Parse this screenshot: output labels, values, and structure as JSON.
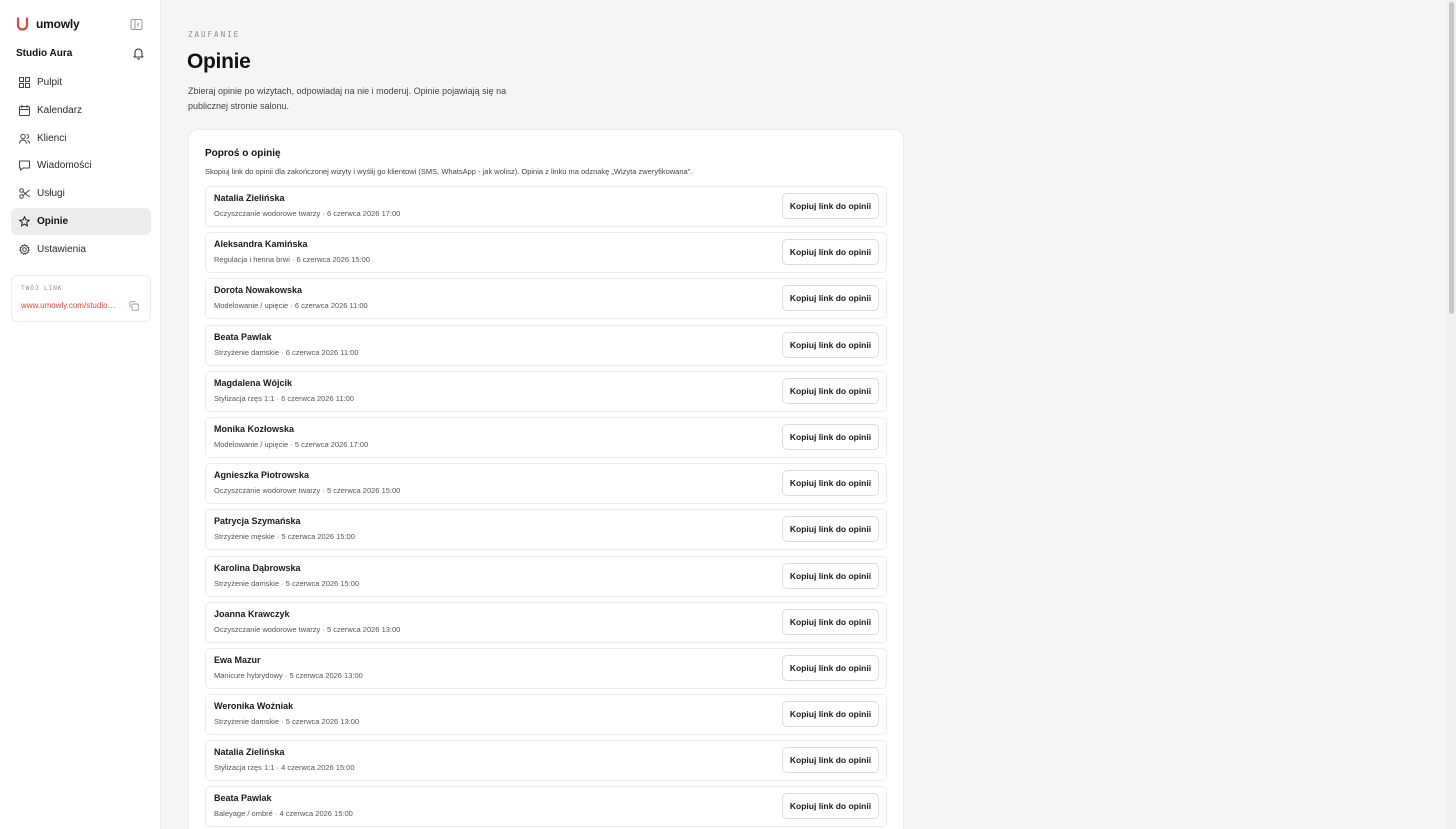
{
  "brand": {
    "name": "umowly",
    "accent": "#e0453a"
  },
  "sidebar": {
    "studio_name": "Studio Aura",
    "items": [
      {
        "label": "Pulpit",
        "icon": "dashboard-icon"
      },
      {
        "label": "Kalendarz",
        "icon": "calendar-icon"
      },
      {
        "label": "Klienci",
        "icon": "users-icon"
      },
      {
        "label": "Wiadomości",
        "icon": "message-icon"
      },
      {
        "label": "Usługi",
        "icon": "scissors-icon"
      },
      {
        "label": "Opinie",
        "icon": "star-icon",
        "active": true
      },
      {
        "label": "Ustawienia",
        "icon": "gear-icon"
      }
    ],
    "link_card": {
      "label": "TWÓJ LINK",
      "url": "www.umowly.com/studio…"
    }
  },
  "header": {
    "eyebrow": "ZAUFANIE",
    "title": "Opinie",
    "description": "Zbieraj opinie po wizytach, odpowiadaj na nie i moderuj. Opinie pojawiają się na publicznej stronie salonu."
  },
  "panel": {
    "title": "Poproś o opinię",
    "description": "Skopiuj link do opinii dla zakończonej wizyty i wyślij go klientowi (SMS, WhatsApp - jak wolisz). Opinia z linku ma odznakę „Wizyta zweryfikowana\".",
    "button_label": "Kopiuj link do opinii",
    "rows": [
      {
        "name": "Natalia Zielińska",
        "meta": "Oczyszczanie wodorowe twarzy · 6 czerwca 2026 17:00"
      },
      {
        "name": "Aleksandra Kamińska",
        "meta": "Regulacja i henna brwi · 6 czerwca 2026 15:00"
      },
      {
        "name": "Dorota Nowakowska",
        "meta": "Modelowanie / upięcie · 6 czerwca 2026 11:00"
      },
      {
        "name": "Beata Pawlak",
        "meta": "Strzyżenie damskie · 6 czerwca 2026 11:00"
      },
      {
        "name": "Magdalena Wójcik",
        "meta": "Stylizacja rzęs 1:1 · 6 czerwca 2026 11:00"
      },
      {
        "name": "Monika Kozłowska",
        "meta": "Modelowanie / upięcie · 5 czerwca 2026 17:00"
      },
      {
        "name": "Agnieszka Piotrowska",
        "meta": "Oczyszczanie wodorowe twarzy · 5 czerwca 2026 15:00"
      },
      {
        "name": "Patrycja Szymańska",
        "meta": "Strzyżenie męskie · 5 czerwca 2026 15:00"
      },
      {
        "name": "Karolina Dąbrowska",
        "meta": "Strzyżenie damskie · 5 czerwca 2026 15:00"
      },
      {
        "name": "Joanna Krawczyk",
        "meta": "Oczyszczanie wodorowe twarzy · 5 czerwca 2026 13:00"
      },
      {
        "name": "Ewa Mazur",
        "meta": "Manicure hybrydowy · 5 czerwca 2026 13:00"
      },
      {
        "name": "Weronika Woźniak",
        "meta": "Strzyżenie damskie · 5 czerwca 2026 13:00"
      },
      {
        "name": "Natalia Zielińska",
        "meta": "Stylizacja rzęs 1:1 · 4 czerwca 2026 15:00"
      },
      {
        "name": "Beata Pawlak",
        "meta": "Baleyage / ombré · 4 czerwca 2026 15:00"
      }
    ]
  }
}
